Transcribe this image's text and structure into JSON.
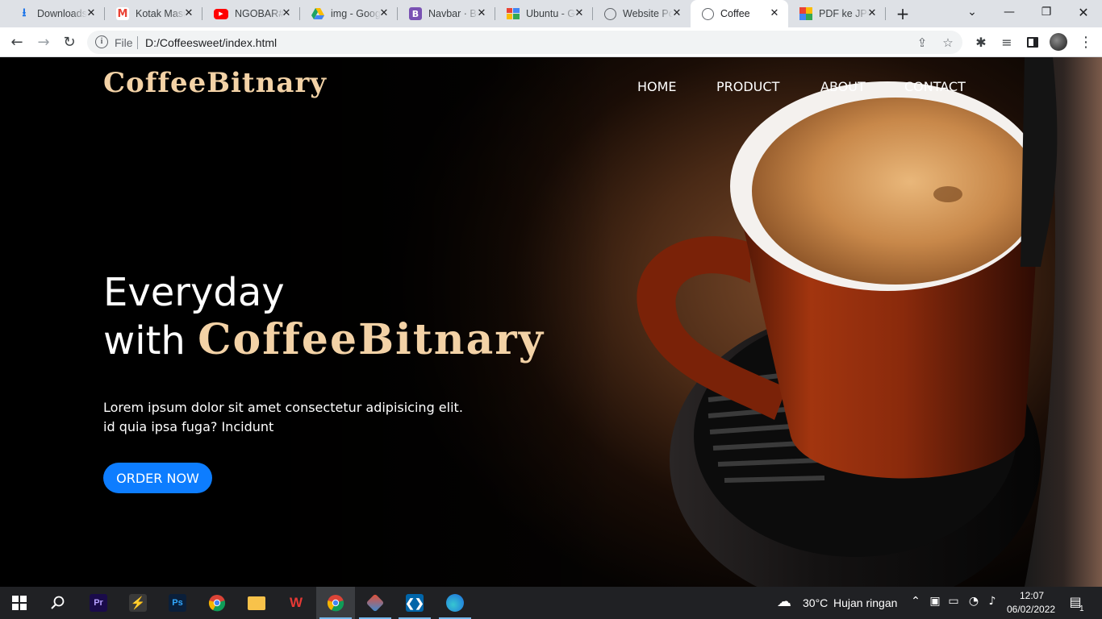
{
  "browser": {
    "tabs": [
      {
        "title": "Downloads",
        "icon": "download-icon",
        "color": "#1a73e8"
      },
      {
        "title": "Kotak Masuk",
        "icon": "gmail-icon",
        "color": "#ea4335"
      },
      {
        "title": "NGOBAR#",
        "icon": "youtube-icon",
        "color": "#ff0000"
      },
      {
        "title": "img - Google Drive",
        "icon": "drive-icon",
        "color": "#34a853"
      },
      {
        "title": "Navbar · Bootstrap",
        "icon": "bootstrap-icon",
        "color": "#7952b3"
      },
      {
        "title": "Ubuntu - Google",
        "icon": "colorful-icon",
        "color": "#4285f4"
      },
      {
        "title": "Website Portfolio",
        "icon": "globe-icon",
        "color": "#5f6368"
      },
      {
        "title": "Coffee",
        "icon": "globe-icon",
        "color": "#5f6368",
        "active": true
      },
      {
        "title": "PDF ke JPG",
        "icon": "pdf-colorful-icon",
        "color": "#e94235"
      }
    ],
    "address": {
      "scheme_label": "File",
      "url": "D:/Coffeesweet/index.html"
    }
  },
  "site": {
    "brand": "CoffeeBitnary",
    "nav": [
      "HOME",
      "PRODUCT",
      "ABOUT",
      "CONTACT"
    ],
    "hero_line1": "Everyday",
    "hero_line2_prefix": "with",
    "hero_brand": "CoffeeBitnary",
    "description_line1": "Lorem ipsum dolor sit amet consectetur adipisicing elit.",
    "description_line2": "id quia ipsa fuga? Incidunt",
    "cta": "ORDER NOW",
    "colors": {
      "brand": "#f3d2a6",
      "cta": "#0d7dff"
    }
  },
  "taskbar": {
    "apps": [
      "windows-start-icon",
      "search-icon",
      "premiere-icon",
      "sublime-icon",
      "photoshop-icon",
      "chrome-icon",
      "file-explorer-icon",
      "wps-icon",
      "chrome-active-icon",
      "git-icon",
      "vscode-icon",
      "edge-icon"
    ],
    "weather_temp": "30°C",
    "weather_text": "Hujan ringan",
    "time": "12:07",
    "date": "06/02/2022",
    "notification_count": "1"
  }
}
